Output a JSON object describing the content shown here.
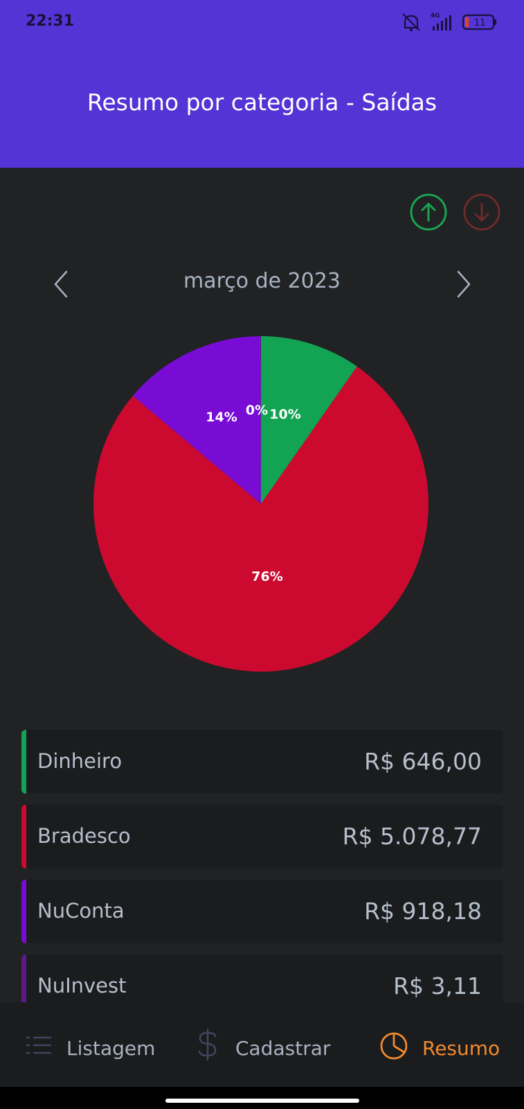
{
  "status_bar": {
    "time": "22:31",
    "network": "4G",
    "battery": "11"
  },
  "header": {
    "title": "Resumo por categoria - Saídas"
  },
  "filters": {
    "income_icon": "arrow-up-circle-icon",
    "expense_icon": "arrow-down-circle-icon",
    "income_color": "#1aa452",
    "expense_color": "#6e2a2a"
  },
  "month_nav": {
    "label": "março de 2023"
  },
  "chart_data": {
    "type": "pie",
    "slices": [
      {
        "label": "Dinheiro",
        "value": 646.0,
        "percent_label": "10%",
        "color": "#13a453"
      },
      {
        "label": "Bradesco",
        "value": 5078.77,
        "percent_label": "76%",
        "color": "#cc0a2f"
      },
      {
        "label": "NuConta",
        "value": 918.18,
        "percent_label": "14%",
        "color": "#780cd4"
      },
      {
        "label": "NuInvest",
        "value": 3.11,
        "percent_label": "0%",
        "color": "#5a1a8a"
      }
    ]
  },
  "categories": [
    {
      "name": "Dinheiro",
      "amount": "R$ 646,00",
      "color": "#13a453"
    },
    {
      "name": "Bradesco",
      "amount": "R$ 5.078,77",
      "color": "#cc0a2f"
    },
    {
      "name": "NuConta",
      "amount": "R$ 918,18",
      "color": "#780cd4"
    },
    {
      "name": "NuInvest",
      "amount": "R$ 3,11",
      "color": "#5a1a8a"
    }
  ],
  "bottom_nav": {
    "items": [
      {
        "label": "Listagem",
        "icon": "list-icon",
        "active": false
      },
      {
        "label": "Cadastrar",
        "icon": "dollar-icon",
        "active": false
      },
      {
        "label": "Resumo",
        "icon": "pie-chart-icon",
        "active": true
      }
    ],
    "active_color": "#f28a2e",
    "inactive_color": "#aab3c2"
  }
}
